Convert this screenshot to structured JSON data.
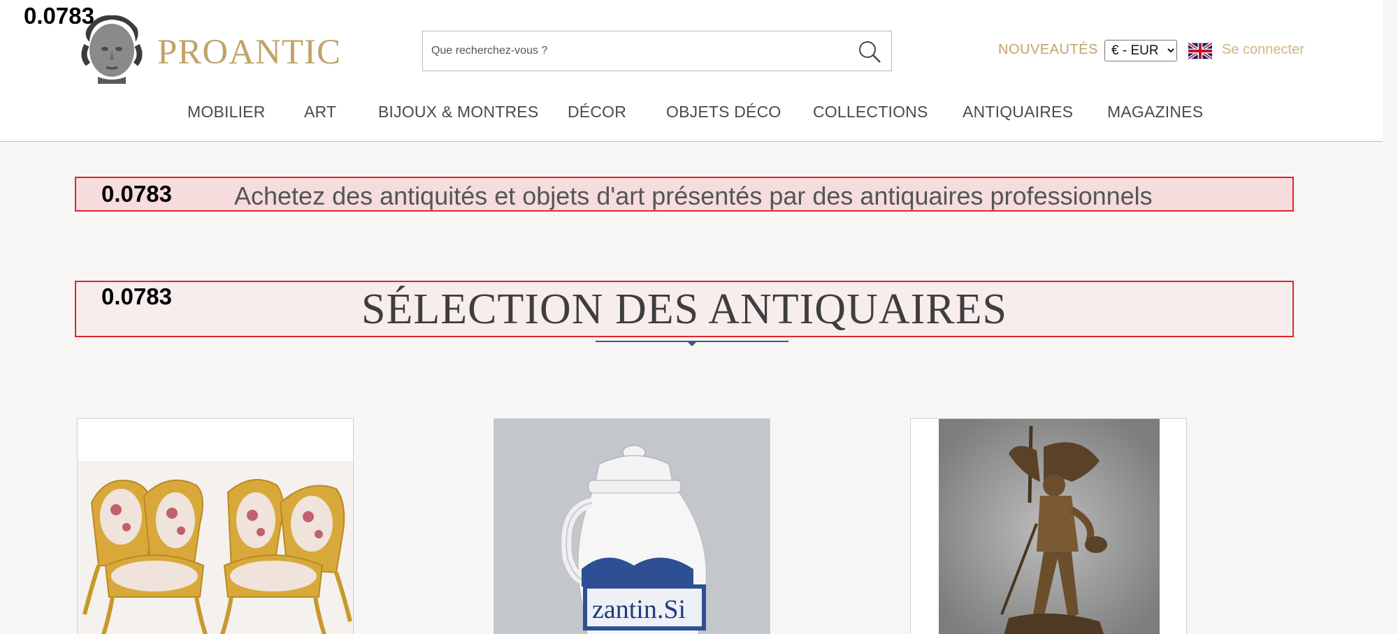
{
  "score": "0.0783",
  "brand": {
    "name": "PROANTIC",
    "color": "#c1a36a",
    "logo_icon": "bust-head-icon"
  },
  "search": {
    "placeholder": "Que recherchez-vous ?",
    "icon": "search-icon"
  },
  "header_links": {
    "new": "NOUVEAUTÉS",
    "login": "Se connecter"
  },
  "currency": {
    "selected": "€ - EUR"
  },
  "language": {
    "icon": "uk-flag-icon"
  },
  "nav": [
    {
      "label": "MOBILIER"
    },
    {
      "label": "ART"
    },
    {
      "label": "BIJOUX & MONTRES"
    },
    {
      "label": "DÉCOR"
    },
    {
      "label": "OBJETS DÉCO"
    },
    {
      "label": "COLLECTIONS"
    },
    {
      "label": "ANTIQUAIRES"
    },
    {
      "label": "MAGAZINES"
    }
  ],
  "banner": {
    "text": "Achetez des antiquités et objets d'art présentés par des antiquaires professionnels"
  },
  "section": {
    "title": "SÉLECTION DES ANTIQUAIRES"
  },
  "products": [
    {
      "image": "gilded-armchairs-image"
    },
    {
      "image": "faience-pharmacy-jug-image"
    },
    {
      "image": "bronze-winged-knight-statue-image"
    }
  ],
  "colors": {
    "accent": "#c1a36a",
    "highlight_border": "#e0262d",
    "divider": "#3e5a7a"
  }
}
